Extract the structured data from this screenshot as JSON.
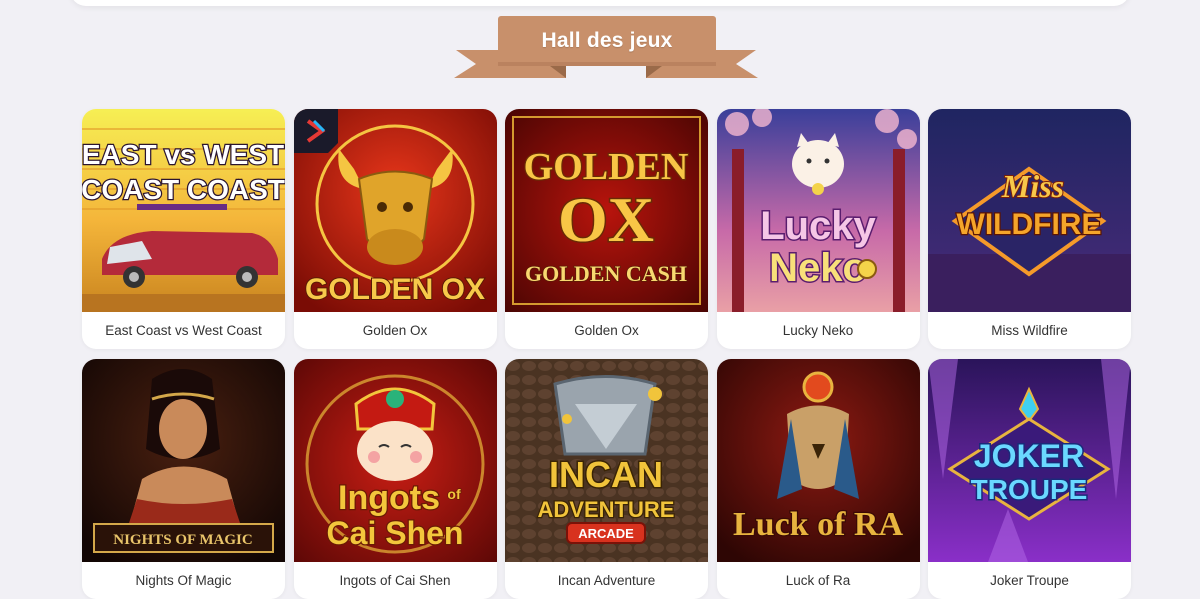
{
  "section": {
    "title": "Hall des jeux",
    "banner_color": "#c8906b",
    "banner_dark": "#b07a57"
  },
  "games": [
    {
      "name": "East Coast vs West Coast",
      "thumb_text": [
        "EAST vs WEST",
        "COAST COAST"
      ],
      "palette": [
        "#f3e640",
        "#f7b733",
        "#6a2c83"
      ],
      "icon": "lowrider-car-icon"
    },
    {
      "name": "Golden Ox",
      "thumb_text": [
        "GOLDEN OX"
      ],
      "palette": [
        "#d3200f",
        "#8e0d06",
        "#f5c542"
      ],
      "icon": "ox-head-icon",
      "provider_badge": true
    },
    {
      "name": "Golden Ox",
      "thumb_text": [
        "GOLDEN",
        "OX",
        "GOLDEN CASH"
      ],
      "palette": [
        "#b8140c",
        "#5e0704",
        "#f8c646"
      ],
      "icon": "ox-logo-icon"
    },
    {
      "name": "Lucky Neko",
      "thumb_text": [
        "Lucky",
        "Neko"
      ],
      "palette": [
        "#3b4fa8",
        "#f29fb9",
        "#f4d34a"
      ],
      "icon": "lucky-cat-icon"
    },
    {
      "name": "Miss Wildfire",
      "thumb_text": [
        "Miss",
        "WILDFIRE"
      ],
      "palette": [
        "#2b2a73",
        "#6b3aa8",
        "#f59a2a"
      ],
      "icon": "fire-diamond-icon"
    },
    {
      "name": "Nights Of Magic",
      "thumb_text": [
        "NIGHTS OF MAGIC"
      ],
      "palette": [
        "#1a0c07",
        "#8e3f22",
        "#d4a84a"
      ],
      "icon": "dancer-icon"
    },
    {
      "name": "Ingots of Cai Shen",
      "thumb_text": [
        "Ingots",
        "of",
        "Cai Shen"
      ],
      "palette": [
        "#8c0f0a",
        "#c91e14",
        "#f3c63c"
      ],
      "icon": "cai-shen-icon"
    },
    {
      "name": "Incan Adventure",
      "thumb_text": [
        "INCAN",
        "ADVENTURE",
        "ARCADE"
      ],
      "palette": [
        "#3d2a1b",
        "#6b4a2e",
        "#f1c43b"
      ],
      "icon": "drill-icon"
    },
    {
      "name": "Luck of Ra",
      "thumb_text": [
        "Luck of RA"
      ],
      "palette": [
        "#4a0d0a",
        "#8e1a12",
        "#e8b43f"
      ],
      "icon": "falcon-ra-icon"
    },
    {
      "name": "Joker Troupe",
      "thumb_text": [
        "JOKER",
        "TROUPE"
      ],
      "palette": [
        "#3a1a6e",
        "#7a2fb8",
        "#4fc3f7"
      ],
      "icon": "jester-gem-icon"
    }
  ]
}
